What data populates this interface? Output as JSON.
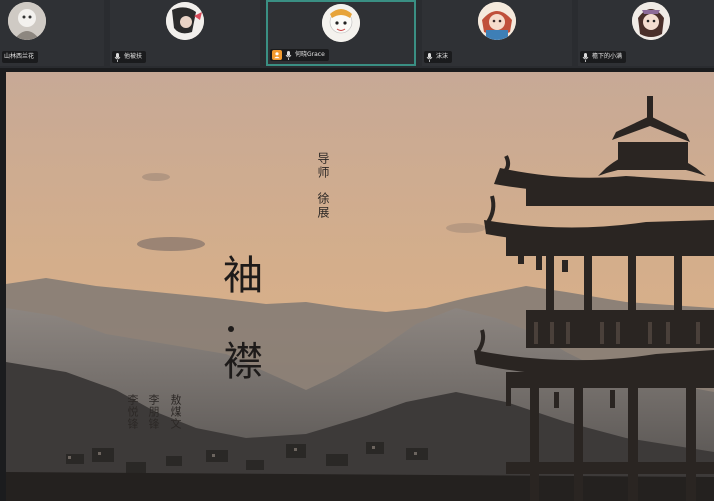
{
  "participants": [
    {
      "name": "山林西兰花",
      "mic": "on",
      "active": false,
      "host": false
    },
    {
      "name": "他被扶",
      "mic": "on",
      "active": false,
      "host": false
    },
    {
      "name": "何晓Grace",
      "mic": "on",
      "active": true,
      "host": true
    },
    {
      "name": "沫沫",
      "mic": "on",
      "active": false,
      "host": false
    },
    {
      "name": "檐下的小满",
      "mic": "on",
      "active": false,
      "host": false
    }
  ],
  "slide": {
    "mentor_label": "导师",
    "mentor_name": "徐展",
    "title_top": "袖",
    "title_bottom": "襟",
    "credits": [
      "敖煤文",
      "李朋锋",
      "李悦锋"
    ]
  },
  "colors": {
    "active_border": "#3a8f83",
    "host_badge": "#f29a2e",
    "tile_bg": "#2f3135"
  }
}
